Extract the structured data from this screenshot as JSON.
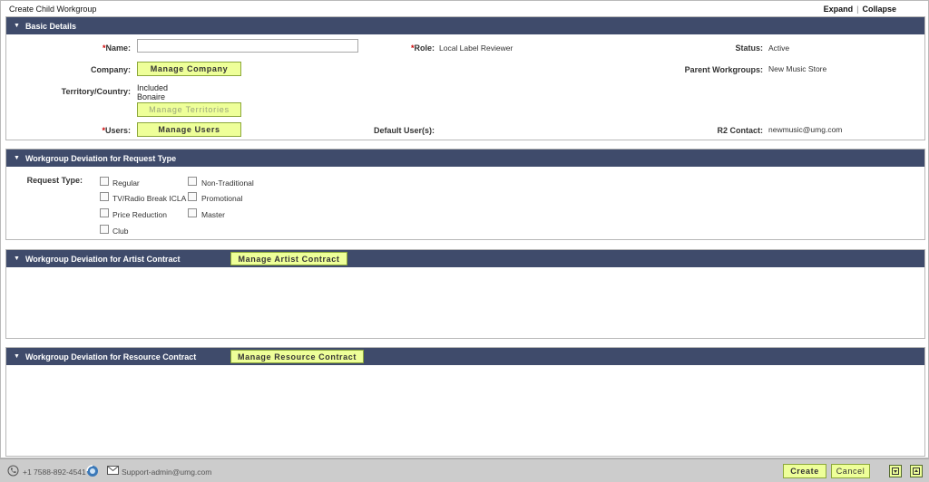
{
  "header": {
    "title": "Create Child Workgroup",
    "expand": "Expand",
    "separator": "|",
    "collapse": "Collapse"
  },
  "basic": {
    "title": "Basic Details",
    "name_label": "Name:",
    "name_value": "",
    "role_label": "Role:",
    "role_value": "Local Label Reviewer",
    "status_label": "Status:",
    "status_value": "Active",
    "company_label": "Company:",
    "manage_company": "Manage Company",
    "parent_label": "Parent Workgroups:",
    "parent_value": "New Music Store",
    "territory_label": "Territory/Country:",
    "territory_included": "Included",
    "territory_value": "Bonaire",
    "manage_territories": "Manage Territories",
    "users_label": "Users:",
    "manage_users": "Manage Users",
    "default_users_label": "Default User(s):",
    "r2_label": "R2 Contact:",
    "r2_value": "newmusic@umg.com",
    "required_mark": "*"
  },
  "request": {
    "title": "Workgroup Deviation for Request Type",
    "type_label": "Request Type:",
    "options": [
      "Regular",
      "TV/Radio Break ICLA",
      "Price Reduction",
      "Club",
      "Non-Traditional",
      "Promotional",
      "Master"
    ]
  },
  "artist": {
    "title": "Workgroup Deviation for Artist Contract",
    "manage_label": "Manage Artist Contract"
  },
  "resource": {
    "title": "Workgroup Deviation for Resource Contract",
    "manage_label": "Manage Resource Contract"
  },
  "footer": {
    "phone": "+1 7588-892-4541",
    "email": "Support-admin@umg.com",
    "create": "Create",
    "cancel": "Cancel"
  },
  "icons": {
    "phone": "phone-icon",
    "support": "support-icon",
    "email": "email-icon",
    "down": "arrow-down-icon",
    "up": "arrow-up-icon"
  },
  "colors": {
    "section_header": "#3f4b6b",
    "button_bg": "#eeff99",
    "button_border": "#8ca83a",
    "required": "#cc0000"
  }
}
